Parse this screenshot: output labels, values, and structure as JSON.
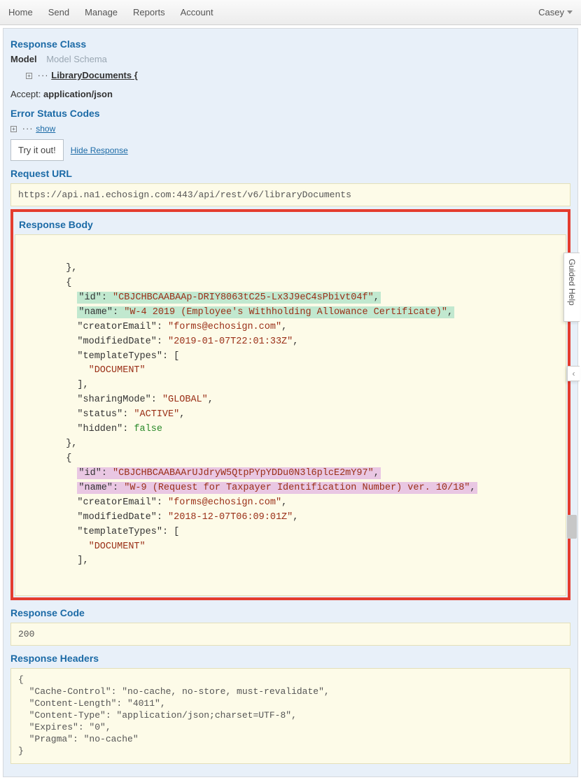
{
  "nav": {
    "items": [
      "Home",
      "Send",
      "Manage",
      "Reports",
      "Account"
    ],
    "user": "Casey"
  },
  "responseClass": {
    "title": "Response Class",
    "tabs": {
      "model": "Model",
      "schema": "Model Schema"
    },
    "modelName": "LibraryDocuments {"
  },
  "accept": {
    "label": "Accept:",
    "value": "application/json"
  },
  "error": {
    "title": "Error Status Codes",
    "showLabel": "show"
  },
  "tryIt": "Try it out!",
  "hideResponse": "Hide Response",
  "requestUrl": {
    "title": "Request URL",
    "value": "https://api.na1.echosign.com:443/api/rest/v6/libraryDocuments"
  },
  "responseBody": {
    "title": "Response Body",
    "items": [
      {
        "id": "CBJCHBCAABAAp-DRIY8063tC25-Lx3J9eC4sPbivt04f",
        "name": "W-4 2019 (Employee's Withholding Allowance Certificate)",
        "creatorEmail": "forms@echosign.com",
        "modifiedDate": "2019-01-07T22:01:33Z",
        "templateTypes": [
          "DOCUMENT"
        ],
        "sharingMode": "GLOBAL",
        "status": "ACTIVE",
        "hidden": false,
        "highlight": "green",
        "truncated": false
      },
      {
        "id": "CBJCHBCAABAArUJdryW5QtpPYpYDDu0N3l6plcE2mY97",
        "name": "W-9 (Request for Taxpayer Identification Number) ver. 10/18",
        "creatorEmail": "forms@echosign.com",
        "modifiedDate": "2018-12-07T06:09:01Z",
        "templateTypes": [
          "DOCUMENT"
        ],
        "highlight": "pink",
        "truncated": true
      }
    ]
  },
  "responseCode": {
    "title": "Response Code",
    "value": "200"
  },
  "responseHeaders": {
    "title": "Response Headers",
    "raw": "{\n  \"Cache-Control\": \"no-cache, no-store, must-revalidate\",\n  \"Content-Length\": \"4011\",\n  \"Content-Type\": \"application/json;charset=UTF-8\",\n  \"Expires\": \"0\",\n  \"Pragma\": \"no-cache\"\n}"
  },
  "guidedHelp": "Guided Help"
}
